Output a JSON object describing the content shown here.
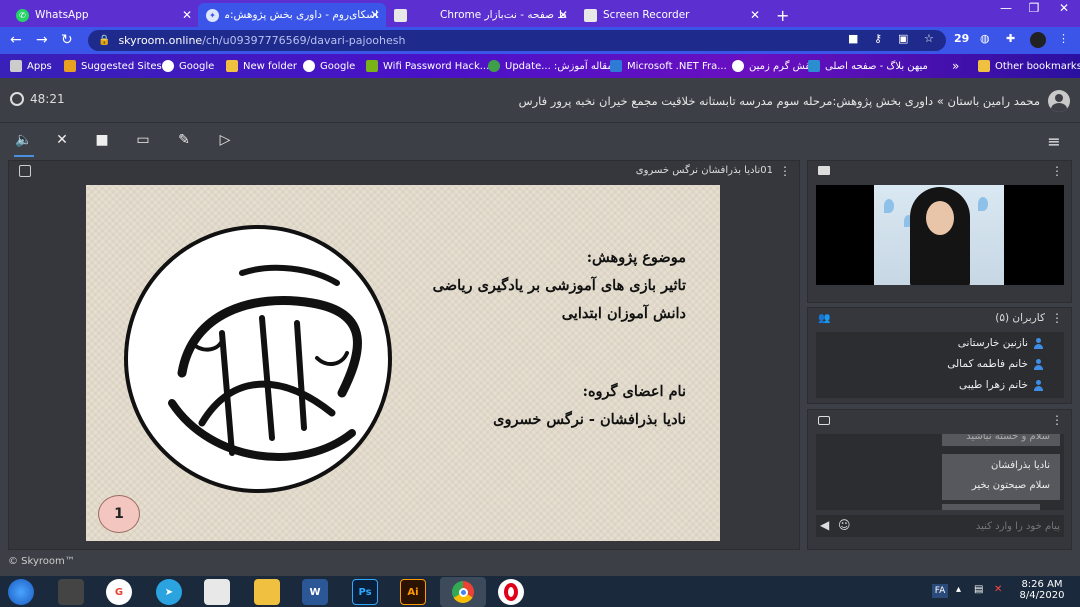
{
  "browser": {
    "tabs": [
      {
        "label": "WhatsApp",
        "active": false
      },
      {
        "label": "اسکای‌روم - داوری بخش پژوهش:مر",
        "active": true
      },
      {
        "label": "",
        "active": false
      },
      {
        "label": "Chrome ضبط صفحه - نت‌بازار",
        "active": false
      },
      {
        "label": "Screen Recorder",
        "active": false
      }
    ],
    "new_tab": "+",
    "url_host": "skyroom.online",
    "url_path": "/ch/u09397776569/davari-pajoohesh",
    "badge_count": "29",
    "bookmarks": [
      {
        "label": "Apps",
        "color": "#e0e0e0"
      },
      {
        "label": "Suggested Sites",
        "color": "#e8a020"
      },
      {
        "label": "Google",
        "color": "#4285f4"
      },
      {
        "label": "New folder",
        "color": "#f0c040"
      },
      {
        "label": "Google",
        "color": "#4285f4"
      },
      {
        "label": "Wifi Password Hack...",
        "color": "#7ab317"
      },
      {
        "label": "Update... :مقاله آموزش",
        "color": "#3fa04a"
      },
      {
        "label": "Microsoft .NET Fra...",
        "color": "#2e7bd6"
      },
      {
        "label": "نقش گرم زمین",
        "color": "#ffffff"
      },
      {
        "label": "میهن بلاگ - صفحه اصلی",
        "color": "#2a8ed0"
      }
    ],
    "more_bookmarks": "»",
    "other_bookmarks": "Other bookmarks"
  },
  "app": {
    "timer": "48:21",
    "room_title": "محمد رامین باستان » داوری بخش پژوهش:مرحله سوم مدرسه تابستانه خلاقیت مجمع خیران نخبه پرور فارس",
    "presenter_label": "01نادیا بذرافشان نرگس خسروی",
    "slide": {
      "line1": "موضوع پژوهش:",
      "line2": "تاثیر بازی های آموزشی بر یادگیری ریاضی",
      "line3": "دانش آموزان ابتدایی",
      "line4": "نام اعضای گروه:",
      "line5": "نادیا بذرافشان - نرگس خسروی",
      "page": "1"
    },
    "users_title": "کاربران (۵)",
    "users": [
      "نازنین خارستانی",
      "خانم فاطمه کمالی",
      "خانم زهرا طیبی"
    ],
    "chat": {
      "partial_message": "سلام و خسته نباشید",
      "sender": "نادیا بذرافشان",
      "message": "سلام صبحتون بخیر",
      "placeholder": "پیام خود را وارد کنید"
    },
    "copyright": "© Skyroom™"
  },
  "taskbar": {
    "lang": "FA",
    "time": "8:26 AM",
    "date": "8/4/2020"
  }
}
